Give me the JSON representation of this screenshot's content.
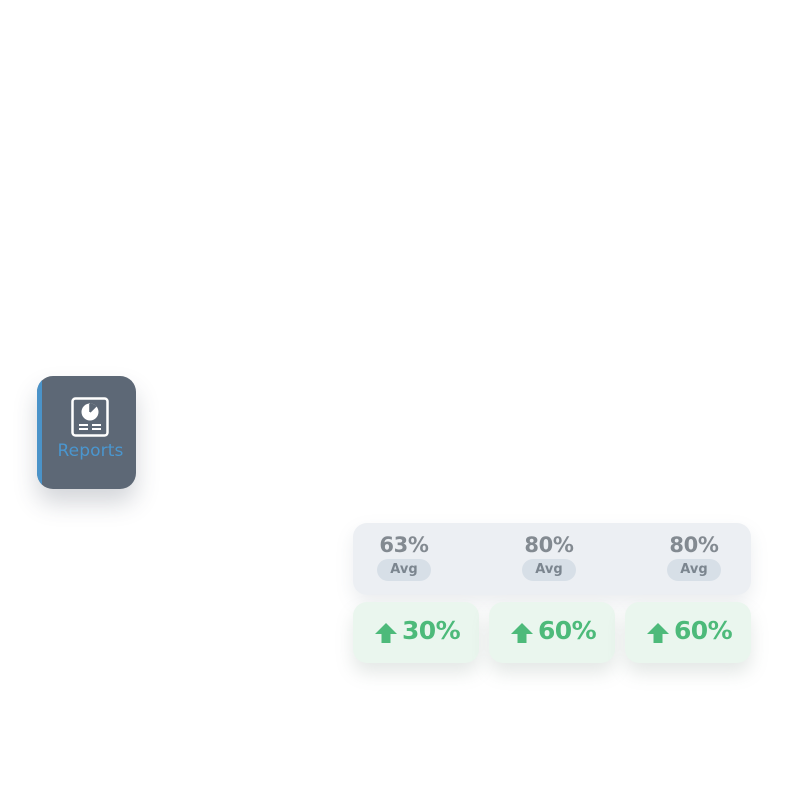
{
  "sidebar": {
    "reports": {
      "label": "Reports",
      "icon": "report-pie-chart-icon",
      "bg_color": "#5d6876",
      "accent_color": "#4a93c9",
      "label_color": "#4a96cf"
    }
  },
  "stats": {
    "averages": [
      {
        "value": "63%",
        "label": "Avg"
      },
      {
        "value": "80%",
        "label": "Avg"
      },
      {
        "value": "80%",
        "label": "Avg"
      }
    ],
    "changes": [
      {
        "value": "30%",
        "direction": "up",
        "icon": "arrow-up-icon"
      },
      {
        "value": "60%",
        "direction": "up",
        "icon": "arrow-up-icon"
      },
      {
        "value": "60%",
        "direction": "up",
        "icon": "arrow-up-icon"
      }
    ],
    "positive_color": "#4dba7a"
  }
}
